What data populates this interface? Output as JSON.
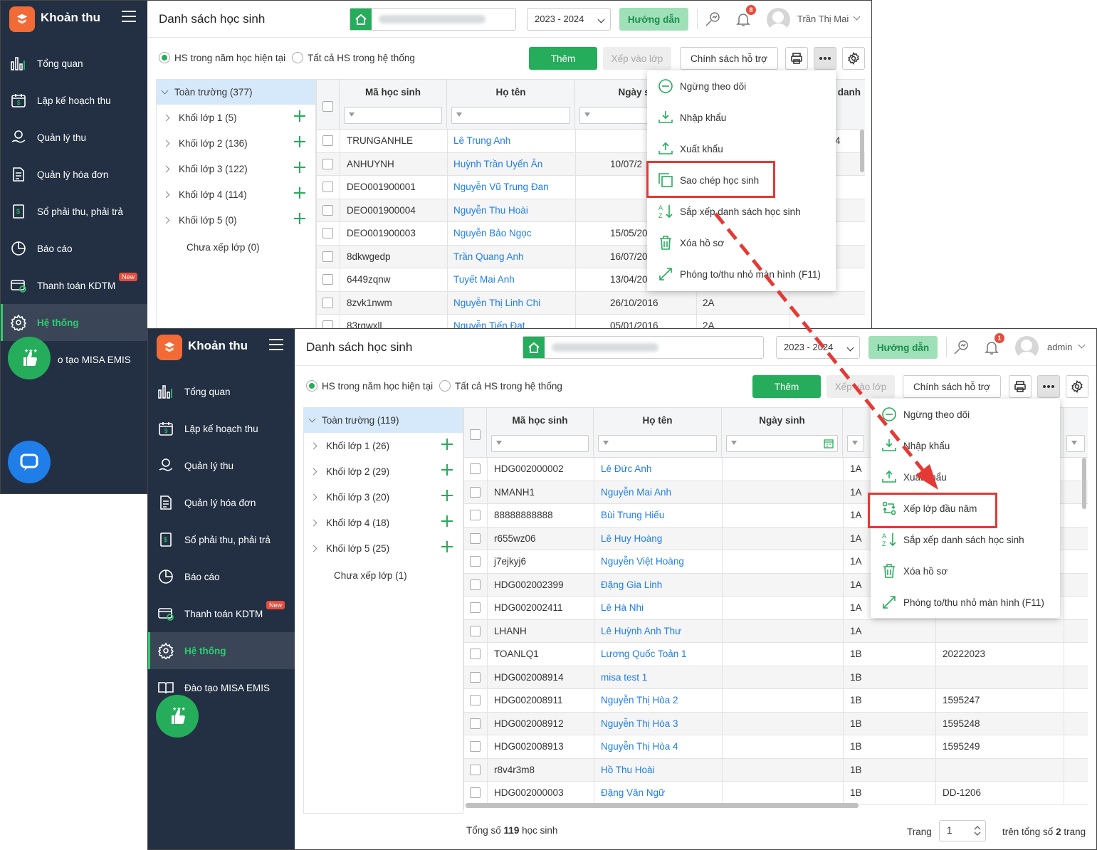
{
  "back": {
    "sidebar": {
      "app_name": "Khoản thu",
      "nav": [
        "Tổng quan",
        "Lập kế hoạch thu",
        "Quản lý thu",
        "Quản lý hóa đơn",
        "Sổ phải thu, phải trả",
        "Báo cáo",
        "Thanh toán KDTM",
        "Hệ thống",
        "o tạo MISA EMIS"
      ],
      "new_badge": "New"
    },
    "header": {
      "title": "Danh sách học sinh",
      "year": "2023 - 2024",
      "guide": "Hướng dẫn",
      "notif_count": "8",
      "user": "Trần Thị Mai"
    },
    "filters": {
      "current": "HS trong năm học hiện tại",
      "all": "Tất cả HS trong hệ thống"
    },
    "toolbar": {
      "add": "Thêm",
      "assign": "Xếp vào lớp",
      "policy": "Chính sách hỗ trợ"
    },
    "tree": {
      "root": "Toàn trường (377)",
      "items": [
        "Khối lớp 1 (5)",
        "Khối lớp 2 (136)",
        "Khối lớp 3 (122)",
        "Khối lớp 4 (114)",
        "Khối lớp 5 (0)"
      ],
      "unassigned": "Chưa xếp lớp (0)"
    },
    "columns": {
      "code": "Mã học sinh",
      "name": "Họ tên",
      "dob": "Ngày si",
      "extra": "danh"
    },
    "rows": [
      {
        "code": "TRUNGANHLE",
        "name": "Lê Trung Anh",
        "dob": "",
        "cls": "",
        "extra": "4"
      },
      {
        "code": "ANHUYNH",
        "name": "Huỳnh Trần Uyển Ân",
        "dob": "10/07/2",
        "cls": "",
        "extra": ""
      },
      {
        "code": "DEO001900001",
        "name": "Nguyễn Vũ Trung Đan",
        "dob": "",
        "cls": "",
        "extra": ""
      },
      {
        "code": "DEO001900004",
        "name": "Nguyễn Thu Hoài",
        "dob": "",
        "cls": "",
        "extra": ""
      },
      {
        "code": "DEO001900003",
        "name": "Nguyễn Bảo Ngọc",
        "dob": "15/05/20",
        "cls": "",
        "extra": ""
      },
      {
        "code": "8dkwgedp",
        "name": "Trần Quang Anh",
        "dob": "16/07/20",
        "cls": "",
        "extra": ""
      },
      {
        "code": "6449zqnw",
        "name": "Tuyết Mai Anh",
        "dob": "13/04/20",
        "cls": "",
        "extra": ""
      },
      {
        "code": "8zvk1nwm",
        "name": "Nguyễn Thị Linh Chi",
        "dob": "26/10/2016",
        "cls": "2A",
        "extra": ""
      },
      {
        "code": "83rqwxll",
        "name": "Nguyễn Tiến Đạt",
        "dob": "05/01/2016",
        "cls": "2A",
        "extra": ""
      }
    ],
    "menu": [
      "Ngừng theo dõi",
      "Nhập khẩu",
      "Xuất khẩu",
      "Sao chép học sinh",
      "Sắp xếp danh sách học sinh",
      "Xóa hồ sơ",
      "Phóng to/thu nhỏ màn hình (F11)"
    ]
  },
  "front": {
    "sidebar": {
      "app_name": "Khoản thu",
      "nav": [
        "Tổng quan",
        "Lập kế hoạch thu",
        "Quản lý thu",
        "Quản lý hóa đơn",
        "Sổ phải thu, phải trả",
        "Báo cáo",
        "Thanh toán KDTM",
        "Hệ thống",
        "Đào tạo MISA EMIS"
      ],
      "new_badge": "New"
    },
    "header": {
      "title": "Danh sách học sinh",
      "year": "2023 - 2024",
      "guide": "Hướng dẫn",
      "notif_count": "1",
      "user": "admin"
    },
    "filters": {
      "current": "HS trong năm học hiện tại",
      "all": "Tất cả HS trong hệ thống"
    },
    "toolbar": {
      "add": "Thêm",
      "assign": "Xếp vào lớp",
      "policy": "Chính sách hỗ trợ"
    },
    "tree": {
      "root": "Toàn trường (119)",
      "items": [
        "Khối lớp 1 (26)",
        "Khối lớp 2 (29)",
        "Khối lớp 3 (20)",
        "Khối lớp 4 (18)",
        "Khối lớp 5 (25)"
      ],
      "unassigned": "Chưa xếp lớp (1)"
    },
    "columns": {
      "code": "Mã học sinh",
      "name": "Họ tên",
      "dob": "Ngày sinh"
    },
    "rows": [
      {
        "code": "HDG002000002",
        "name": "Lê Đức Anh",
        "cls": "1A",
        "extra": ""
      },
      {
        "code": "NMANH1",
        "name": "Nguyễn Mai Anh",
        "cls": "1A",
        "extra": ""
      },
      {
        "code": "88888888888",
        "name": "Bùi Trung Hiếu",
        "cls": "1A",
        "extra": ""
      },
      {
        "code": "r655wz06",
        "name": "Lê Huy Hoàng",
        "cls": "1A",
        "extra": ""
      },
      {
        "code": "j7ejkyj6",
        "name": "Nguyễn Việt Hoàng",
        "cls": "1A",
        "extra": ""
      },
      {
        "code": "HDG002002399",
        "name": "Đặng Gia Linh",
        "cls": "1A",
        "extra": ""
      },
      {
        "code": "HDG002002411",
        "name": "Lê Hà Nhi",
        "cls": "1A",
        "extra": ""
      },
      {
        "code": "LHANH",
        "name": "Lê Huỳnh Anh Thư",
        "cls": "1A",
        "extra": ""
      },
      {
        "code": "TOANLQ1",
        "name": "Lương Quốc Toản 1",
        "cls": "1B",
        "extra": "20222023"
      },
      {
        "code": "HDG002008914",
        "name": "misa test 1",
        "cls": "1B",
        "extra": ""
      },
      {
        "code": "HDG002008911",
        "name": "Nguyễn Thị Hòa 2",
        "cls": "1B",
        "extra": "1595247"
      },
      {
        "code": "HDG002008912",
        "name": "Nguyễn Thị Hòa 3",
        "cls": "1B",
        "extra": "1595248"
      },
      {
        "code": "HDG002008913",
        "name": "Nguyễn Thị Hòa 4",
        "cls": "1B",
        "extra": "1595249"
      },
      {
        "code": "r8v4r3m8",
        "name": "Hồ Thu Hoài",
        "cls": "1B",
        "extra": ""
      },
      {
        "code": "HDG002000003",
        "name": "Đặng Văn Ngữ",
        "cls": "1B",
        "extra": "DD-1206"
      }
    ],
    "menu": [
      "Ngừng theo dõi",
      "Nhập khẩu",
      "Xuất khẩu",
      "Xếp lớp đầu năm",
      "Sắp xếp danh sách học sinh",
      "Xóa hồ sơ",
      "Phóng to/thu nhỏ màn hình (F11)"
    ],
    "footer": {
      "total_prefix": "Tổng số",
      "total": "119",
      "total_suffix": "học sinh",
      "page_label": "Trang",
      "page": "1",
      "of_prefix": "trên tổng số",
      "pages": "2",
      "of_suffix": "trang"
    }
  },
  "icons": [
    "logo-icon",
    "menu-icon",
    "home-icon",
    "chevron-down-icon",
    "analytics-icon",
    "bell-icon",
    "user-avatar-icon",
    "print-icon",
    "more-icon",
    "settings-icon",
    "filter-icon",
    "calendar-icon",
    "plus-icon",
    "chat-icon",
    "like-icon"
  ],
  "colors": {
    "sidebar": "#233043",
    "accent": "#25ad5b",
    "link": "#1f7ee8",
    "highlight": "#e53935",
    "logo": "#f26a35"
  }
}
